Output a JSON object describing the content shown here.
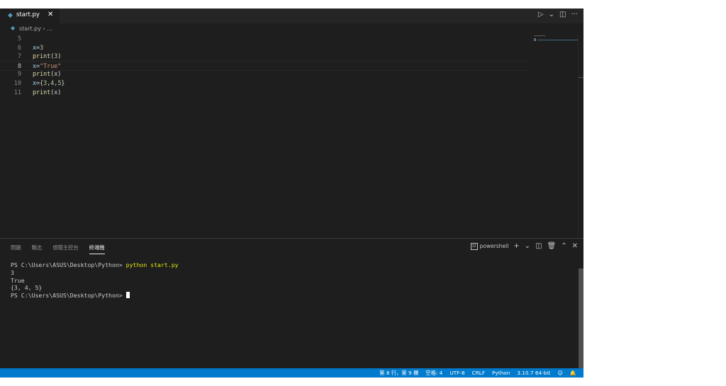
{
  "tab": {
    "filename": "start.py",
    "close": "✕"
  },
  "tab_actions": {
    "run": "▷",
    "run_menu": "⌄",
    "split": "◫",
    "more": "···"
  },
  "breadcrumb": {
    "file": "start.py",
    "sep": "›",
    "more": "..."
  },
  "editor": {
    "lines": [
      {
        "num": "5",
        "code": ""
      },
      {
        "num": "6",
        "code": "x=3"
      },
      {
        "num": "7",
        "code": "print(3)"
      },
      {
        "num": "8",
        "code": "x=\"True\""
      },
      {
        "num": "9",
        "code": "print(x)"
      },
      {
        "num": "10",
        "code": "x={3,4,5}"
      },
      {
        "num": "11",
        "code": "print(x)"
      }
    ]
  },
  "panel": {
    "tabs": [
      "問題",
      "輸出",
      "偵錯主控台",
      "終端機"
    ],
    "shell": "powershell",
    "icons": {
      "terminal": "⊡",
      "add": "+",
      "dropdown": "⌄",
      "split": "◫",
      "trash": "🗑",
      "maximize": "⌃",
      "close": "✕"
    }
  },
  "terminal": {
    "prompt1": "PS C:\\Users\\ASUS\\Desktop\\Python> ",
    "command": "python start.py",
    "out1": "3",
    "out2": "True",
    "out3": "{3, 4, 5}",
    "prompt2": "PS C:\\Users\\ASUS\\Desktop\\Python> "
  },
  "status": {
    "position": "第 8 行，第 9 欄",
    "spaces": "空格: 4",
    "encoding": "UTF-8",
    "eol": "CRLF",
    "language": "Python",
    "interpreter": "3.10.7 64-bit",
    "feedback_icon": "☺",
    "bell_icon": "🔔"
  }
}
